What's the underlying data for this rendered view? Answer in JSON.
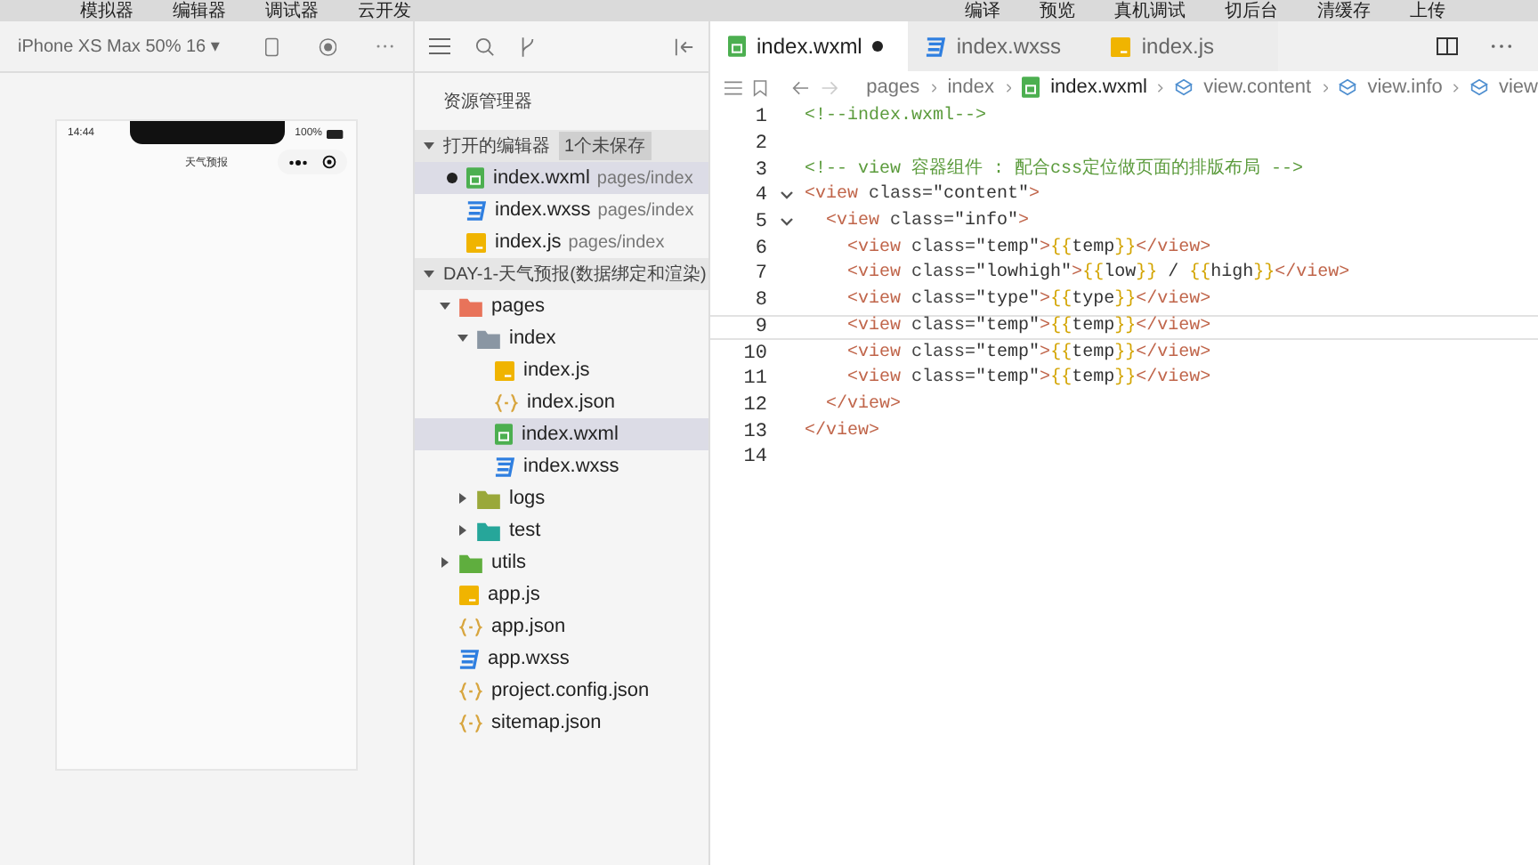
{
  "menu_bar": {
    "left": [
      "模拟器",
      "编辑器",
      "调试器",
      "云开发"
    ],
    "right": [
      "编译",
      "预览",
      "真机调试",
      "切后台",
      "清缓存",
      "上传"
    ]
  },
  "simulator": {
    "device": "iPhone XS Max 50% 16 ▾",
    "status_time": "14:44",
    "battery_text": "100%",
    "nav_title": "天气预报"
  },
  "explorer": {
    "title": "资源管理器",
    "open_editors": {
      "label": "打开的编辑器",
      "badge": "1个未保存",
      "expanded": true,
      "items": [
        {
          "name": "index.wxml",
          "path": "pages/index",
          "kind": "wxml",
          "dirty": true,
          "selected": true
        },
        {
          "name": "index.wxss",
          "path": "pages/index",
          "kind": "wxss",
          "dirty": false,
          "selected": false
        },
        {
          "name": "index.js",
          "path": "pages/index",
          "kind": "js",
          "dirty": false,
          "selected": false
        }
      ]
    },
    "project": {
      "label": "DAY-1-天气预报(数据绑定和渲染)",
      "expanded": true,
      "tree": [
        {
          "name": "pages",
          "kind": "folder",
          "color": "#e8735a",
          "expanded": true,
          "selected": false,
          "children": [
            {
              "name": "index",
              "kind": "folder",
              "color": "#8a96a3",
              "expanded": true,
              "selected": false,
              "children": [
                {
                  "name": "index.js",
                  "kind": "js",
                  "selected": false
                },
                {
                  "name": "index.json",
                  "kind": "json",
                  "selected": false
                },
                {
                  "name": "index.wxml",
                  "kind": "wxml",
                  "selected": true
                },
                {
                  "name": "index.wxss",
                  "kind": "wxss",
                  "selected": false
                }
              ]
            },
            {
              "name": "logs",
              "kind": "folder",
              "color": "#9aa83a",
              "expanded": false,
              "selected": false
            },
            {
              "name": "test",
              "kind": "folder",
              "color": "#26a69a",
              "expanded": false,
              "selected": false
            }
          ]
        },
        {
          "name": "utils",
          "kind": "folder",
          "color": "#5fae3e",
          "expanded": false,
          "selected": false
        },
        {
          "name": "app.js",
          "kind": "js",
          "selected": false
        },
        {
          "name": "app.json",
          "kind": "json",
          "selected": false
        },
        {
          "name": "app.wxss",
          "kind": "wxss",
          "selected": false
        },
        {
          "name": "project.config.json",
          "kind": "json",
          "selected": false
        },
        {
          "name": "sitemap.json",
          "kind": "json",
          "selected": false
        }
      ]
    }
  },
  "editor": {
    "tabs": [
      {
        "name": "index.wxml",
        "kind": "wxml",
        "selected": true,
        "dirty": true
      },
      {
        "name": "index.wxss",
        "kind": "wxss",
        "selected": false,
        "dirty": false
      },
      {
        "name": "index.js",
        "kind": "js",
        "selected": false,
        "dirty": false
      }
    ],
    "breadcrumb": [
      {
        "text": "pages",
        "kind": "folder"
      },
      {
        "text": "index",
        "kind": "folder"
      },
      {
        "text": "index.wxml",
        "kind": "wxml"
      },
      {
        "text": "view.content",
        "kind": "element"
      },
      {
        "text": "view.info",
        "kind": "element"
      },
      {
        "text": "view",
        "kind": "element"
      }
    ],
    "lines": [
      {
        "number": "1",
        "current": false,
        "tokens": [
          {
            "kind": "comment",
            "text": "<!--index.wxml-->"
          }
        ]
      },
      {
        "number": "2",
        "current": false
      },
      {
        "number": "3",
        "current": false,
        "tokens": [
          {
            "kind": "comment",
            "text": "<!-- view 容器组件 : 配合css定位做页面的排版布局 -->"
          }
        ]
      },
      {
        "number": "4",
        "current": false,
        "fold": true,
        "tokens": [
          {
            "kind": "tag",
            "text": "<view"
          },
          {
            "kind": "attr",
            "text": " class="
          },
          {
            "kind": "string",
            "text": "\"content\""
          },
          {
            "kind": "tag",
            "text": ">"
          }
        ]
      },
      {
        "number": "5",
        "current": false,
        "fold": true,
        "tokens": [
          {
            "kind": "tag",
            "text": "  <view"
          },
          {
            "kind": "attr",
            "text": " class="
          },
          {
            "kind": "string",
            "text": "\"info\""
          },
          {
            "kind": "tag",
            "text": ">"
          }
        ]
      },
      {
        "number": "6",
        "current": false,
        "tokens": [
          {
            "kind": "tag",
            "text": "    <view"
          },
          {
            "kind": "attr",
            "text": " class="
          },
          {
            "kind": "string",
            "text": "\"temp\""
          },
          {
            "kind": "tag",
            "text": ">"
          },
          {
            "kind": "brace",
            "text": "{{"
          },
          {
            "kind": "var",
            "text": "temp"
          },
          {
            "kind": "brace",
            "text": "}}"
          },
          {
            "kind": "tag",
            "text": "</view>"
          }
        ]
      },
      {
        "number": "7",
        "current": false,
        "tokens": [
          {
            "kind": "tag",
            "text": "    <view"
          },
          {
            "kind": "attr",
            "text": " class="
          },
          {
            "kind": "string",
            "text": "\"lowhigh\""
          },
          {
            "kind": "tag",
            "text": ">"
          },
          {
            "kind": "brace",
            "text": "{{"
          },
          {
            "kind": "var",
            "text": "low"
          },
          {
            "kind": "brace",
            "text": "}}"
          },
          {
            "kind": "var",
            "text": " / "
          },
          {
            "kind": "brace",
            "text": "{{"
          },
          {
            "kind": "var",
            "text": "high"
          },
          {
            "kind": "brace",
            "text": "}}"
          },
          {
            "kind": "tag",
            "text": "</view>"
          }
        ]
      },
      {
        "number": "8",
        "current": false,
        "tokens": [
          {
            "kind": "tag",
            "text": "    <view"
          },
          {
            "kind": "attr",
            "text": " class="
          },
          {
            "kind": "string",
            "text": "\"type\""
          },
          {
            "kind": "tag",
            "text": ">"
          },
          {
            "kind": "brace",
            "text": "{{"
          },
          {
            "kind": "var",
            "text": "type"
          },
          {
            "kind": "brace",
            "text": "}}"
          },
          {
            "kind": "tag",
            "text": "</view>"
          }
        ]
      },
      {
        "number": "9",
        "current": true,
        "tokens": [
          {
            "kind": "tag",
            "text": "    <view"
          },
          {
            "kind": "attr",
            "text": " class="
          },
          {
            "kind": "string",
            "text": "\"temp\""
          },
          {
            "kind": "tag",
            "text": ">"
          },
          {
            "kind": "brace",
            "text": "{{"
          },
          {
            "kind": "var",
            "text": "temp"
          },
          {
            "kind": "brace",
            "text": "}}"
          },
          {
            "kind": "tag",
            "text": "</view>"
          }
        ]
      },
      {
        "number": "10",
        "current": false,
        "tokens": [
          {
            "kind": "tag",
            "text": "    <view"
          },
          {
            "kind": "attr",
            "text": " class="
          },
          {
            "kind": "string",
            "text": "\"temp\""
          },
          {
            "kind": "tag",
            "text": ">"
          },
          {
            "kind": "brace",
            "text": "{{"
          },
          {
            "kind": "var",
            "text": "temp"
          },
          {
            "kind": "brace",
            "text": "}}"
          },
          {
            "kind": "tag",
            "text": "</view>"
          }
        ]
      },
      {
        "number": "11",
        "current": false,
        "tokens": [
          {
            "kind": "tag",
            "text": "    <view"
          },
          {
            "kind": "attr",
            "text": " class="
          },
          {
            "kind": "string",
            "text": "\"temp\""
          },
          {
            "kind": "tag",
            "text": ">"
          },
          {
            "kind": "brace",
            "text": "{{"
          },
          {
            "kind": "var",
            "text": "temp"
          },
          {
            "kind": "brace",
            "text": "}}"
          },
          {
            "kind": "tag",
            "text": "</view>"
          }
        ]
      },
      {
        "number": "12",
        "current": false,
        "tokens": [
          {
            "kind": "tag",
            "text": "  </view>"
          }
        ]
      },
      {
        "number": "13",
        "current": false,
        "tokens": [
          {
            "kind": "tag",
            "text": "</view>"
          }
        ]
      },
      {
        "number": "14",
        "current": false
      }
    ]
  }
}
